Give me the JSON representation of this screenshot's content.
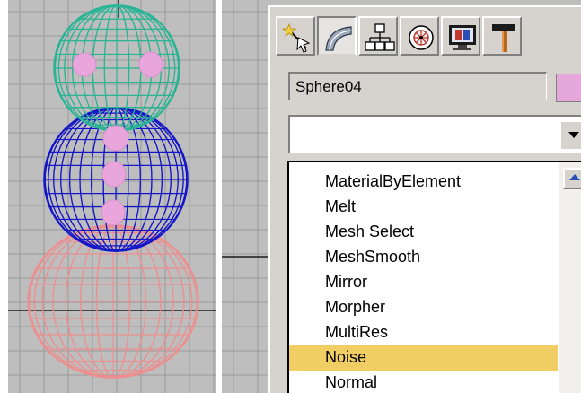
{
  "colors": {
    "viewport_background": "#bebebe",
    "head_wire": "#29b594",
    "body_wire": "#1515c8",
    "base_wire": "#ec8f8f",
    "button_dots": "#e8a6dc",
    "panel_background": "#d6d3ce",
    "selected_item": "#f1ce63",
    "object_color_swatch": "#e6a7dc"
  },
  "command_panel": {
    "tabs": [
      {
        "icon": "create-wand-icon",
        "active": false
      },
      {
        "icon": "modify-bend-icon",
        "active": true
      },
      {
        "icon": "hierarchy-icon",
        "active": false
      },
      {
        "icon": "motion-icon",
        "active": false
      },
      {
        "icon": "display-monitor-icon",
        "active": false
      },
      {
        "icon": "utilities-hammer-icon",
        "active": false
      }
    ],
    "object_name": "Sphere04",
    "modifier_list": {
      "current_value": "",
      "items": [
        {
          "label": "MaterialByElement",
          "selected": false
        },
        {
          "label": "Melt",
          "selected": false
        },
        {
          "label": "Mesh Select",
          "selected": false
        },
        {
          "label": "MeshSmooth",
          "selected": false
        },
        {
          "label": "Mirror",
          "selected": false
        },
        {
          "label": "Morpher",
          "selected": false
        },
        {
          "label": "MultiRes",
          "selected": false
        },
        {
          "label": "Noise",
          "selected": true
        },
        {
          "label": "Normal",
          "selected": false
        }
      ]
    }
  }
}
